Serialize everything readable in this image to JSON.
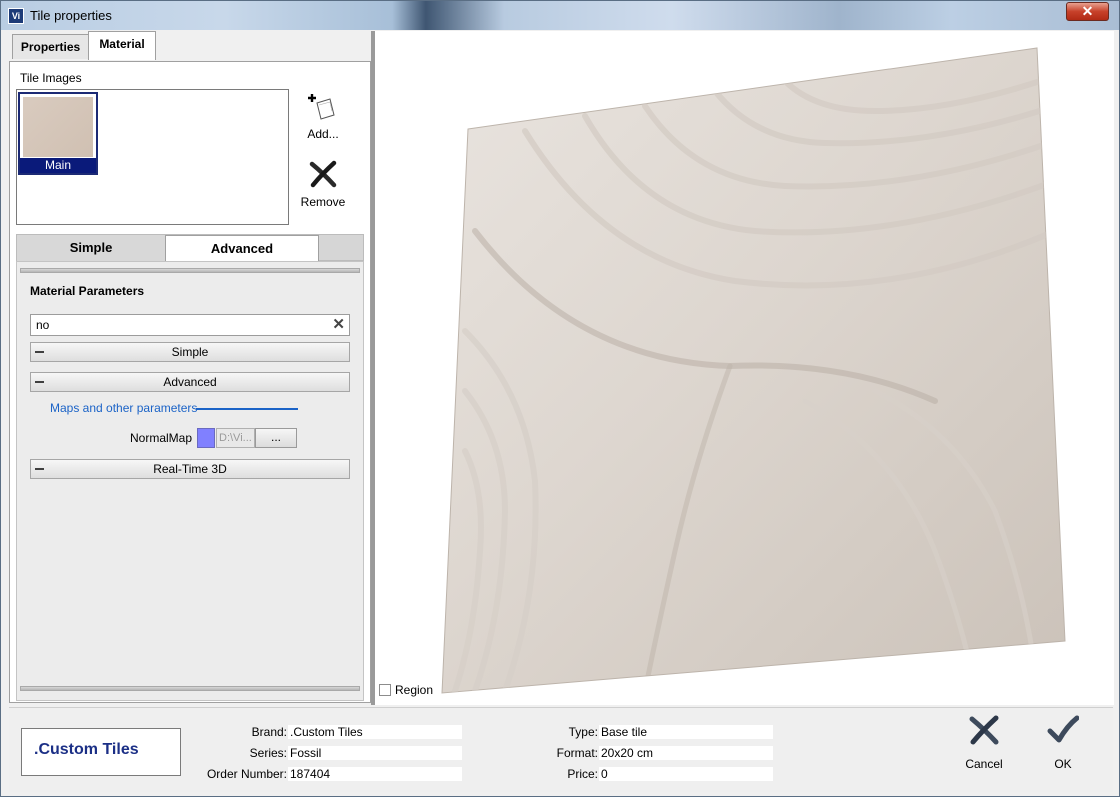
{
  "window": {
    "title": "Tile properties",
    "app_icon_text": "Vi",
    "close_glyph": "✕"
  },
  "tabs": [
    {
      "label": "Properties",
      "active": false
    },
    {
      "label": "Material",
      "active": true
    }
  ],
  "tile_images": {
    "label": "Tile Images",
    "items": [
      {
        "caption": "Main",
        "selected": true
      }
    ],
    "add_label": "Add...",
    "remove_label": "Remove"
  },
  "mode_tabs": [
    {
      "label": "Simple",
      "active": false
    },
    {
      "label": "Advanced",
      "active": true
    }
  ],
  "material_parameters": {
    "title": "Material Parameters",
    "search_value": "no",
    "groups": {
      "simple": {
        "label": "Simple",
        "expanded": true
      },
      "advanced": {
        "label": "Advanced",
        "expanded": true
      },
      "realtime": {
        "label": "Real-Time 3D",
        "expanded": true
      }
    },
    "maps_section": "Maps and other parameters",
    "normal_map": {
      "label": "NormalMap",
      "color": "#8080ff",
      "path": "D:\\Vi...",
      "browse": "..."
    }
  },
  "preview": {
    "region_label": "Region",
    "region_checked": false
  },
  "info": {
    "brand_logo_text": ".Custom Tiles",
    "brand_label": "Brand:",
    "brand_value": ".Custom Tiles",
    "series_label": "Series:",
    "series_value": "Fossil",
    "order_label": "Order Number:",
    "order_value": "187404",
    "type_label": "Type:",
    "type_value": "Base tile",
    "format_label": "Format:",
    "format_value": "20x20 cm",
    "price_label": "Price:",
    "price_value": "0"
  },
  "buttons": {
    "cancel": "Cancel",
    "ok": "OK"
  },
  "colors": {
    "selection": "#0a1a7a",
    "link": "#1b63c7",
    "brand": "#1b2f86",
    "tile": "#d6cdc4"
  }
}
